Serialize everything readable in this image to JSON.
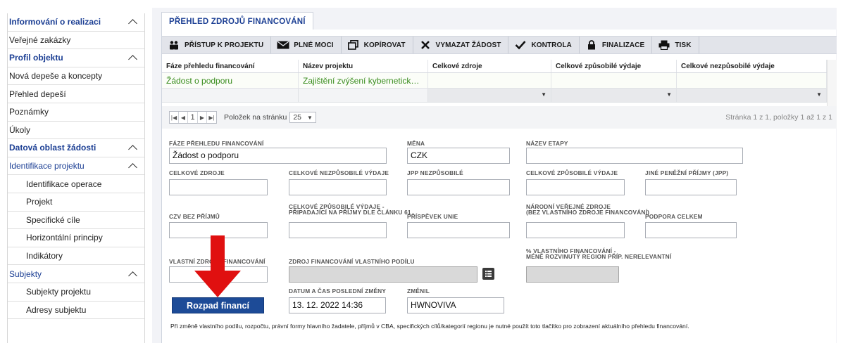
{
  "sidebar": {
    "items": [
      {
        "label": "Informování o realizaci",
        "type": "sec",
        "chevron": true
      },
      {
        "label": "Veřejné zakázky",
        "type": "item"
      },
      {
        "label": "Profil objektu",
        "type": "sec",
        "chevron": true
      },
      {
        "label": "Nová depeše a koncepty",
        "type": "item"
      },
      {
        "label": "Přehled depeší",
        "type": "item"
      },
      {
        "label": "Poznámky",
        "type": "item"
      },
      {
        "label": "Úkoly",
        "type": "item"
      },
      {
        "label": "Datová oblast žádosti",
        "type": "sec",
        "chevron": true
      },
      {
        "label": "Identifikace projektu",
        "type": "group",
        "chevron": true
      },
      {
        "label": "Identifikace operace",
        "type": "sub"
      },
      {
        "label": "Projekt",
        "type": "sub"
      },
      {
        "label": "Specifické cíle",
        "type": "sub"
      },
      {
        "label": "Horizontální principy",
        "type": "sub"
      },
      {
        "label": "Indikátory",
        "type": "sub"
      },
      {
        "label": "Subjekty",
        "type": "group",
        "chevron": true
      },
      {
        "label": "Subjekty projektu",
        "type": "sub"
      },
      {
        "label": "Adresy subjektu",
        "type": "sub"
      }
    ]
  },
  "tab": {
    "label": "PŘEHLED ZDROJŮ FINANCOVÁNÍ"
  },
  "toolbar": {
    "buttons": [
      {
        "label": "PŘÍSTUP K PROJEKTU",
        "icon": "users-icon"
      },
      {
        "label": "PLNÉ MOCI",
        "icon": "envelope-icon"
      },
      {
        "label": "KOPÍROVAT",
        "icon": "copy-icon"
      },
      {
        "label": "VYMAZAT ŽÁDOST",
        "icon": "delete-icon"
      },
      {
        "label": "KONTROLA",
        "icon": "check-icon"
      },
      {
        "label": "FINALIZACE",
        "icon": "lock-icon"
      },
      {
        "label": "TISK",
        "icon": "printer-icon"
      }
    ]
  },
  "grid": {
    "headers": [
      "Fáze přehledu financování",
      "Název projektu",
      "Celkové zdroje",
      "Celkové způsobilé výdaje",
      "Celkové nezpůsobilé výdaje"
    ],
    "rows": [
      [
        "Žádost o podporu",
        "Zajištění zvýšení kybernetické b...",
        "",
        "",
        ""
      ]
    ]
  },
  "pager": {
    "current_page": "1",
    "per_page_label": "Položek na stránku",
    "per_page_value": "25",
    "info": "Stránka 1 z 1, položky 1 až 1 z 1"
  },
  "form": {
    "faze_label": "FÁZE PŘEHLEDU FINANCOVÁNÍ",
    "faze_value": "Žádost o podporu",
    "mena_label": "MĚNA",
    "mena_value": "CZK",
    "etapa_label": "NÁZEV ETAPY",
    "etapa_value": "",
    "zdroje_label": "CELKOVÉ ZDROJE",
    "nezpusobile_label": "CELKOVÉ NEZPŮSOBILÉ VÝDAJE",
    "jpp_label": "JPP NEZPŮSOBILÉ",
    "zpusobile_label": "CELKOVÉ ZPŮSOBILÉ VÝDAJE",
    "jine_label": "JINÉ PENĚŽNÍ PŘÍJMY (JPP)",
    "czv_label": "CZV BEZ PŘÍJMŮ",
    "czv61_label_1": "CELKOVÉ ZPŮSOBILÉ VÝDAJE -",
    "czv61_label_2": "PŘIPADAJÍCÍ NA PŘÍJMY DLE ČLÁNKU 61",
    "prispevek_label": "PŘÍSPĚVEK UNIE",
    "narodni_label_1": "NÁRODNÍ VEŘEJNÉ ZDROJE",
    "narodni_label_2": "(BEZ VLASTNÍHO ZDROJE FINANCOVÁNÍ)",
    "podpora_label": "PODPORA CELKEM",
    "vlastni_label": "VLASTNÍ ZDROJE FINANCOVÁNÍ",
    "zdroj_vlastni_label": "ZDROJ FINANCOVÁNÍ VLASTNÍHO PODÍLU",
    "procento_label_1": "% VLASTNÍHO FINANCOVÁNÍ -",
    "procento_label_2": "MÉNĚ ROZVINUTÝ REGION PŘÍP. NERELEVANTNÍ",
    "datum_label": "DATUM A ČAS POSLEDNÍ ZMĚNY",
    "datum_value": "13. 12. 2022 14:36",
    "zmenil_label": "ZMĚNIL",
    "zmenil_value": "HWNOVIVA",
    "rozpad_button": "Rozpad financí",
    "note": "Při změně vlastního podílu, rozpočtu, právní formy hlavního žadatele, příjmů v CBA, specifických cílů/kategorií regionu je nutné použít toto tlačítko pro zobrazení aktuálního přehledu financování."
  },
  "colors": {
    "accent": "#1d4b97",
    "link_green": "#3a8d1f",
    "arrow": "#e01010"
  }
}
